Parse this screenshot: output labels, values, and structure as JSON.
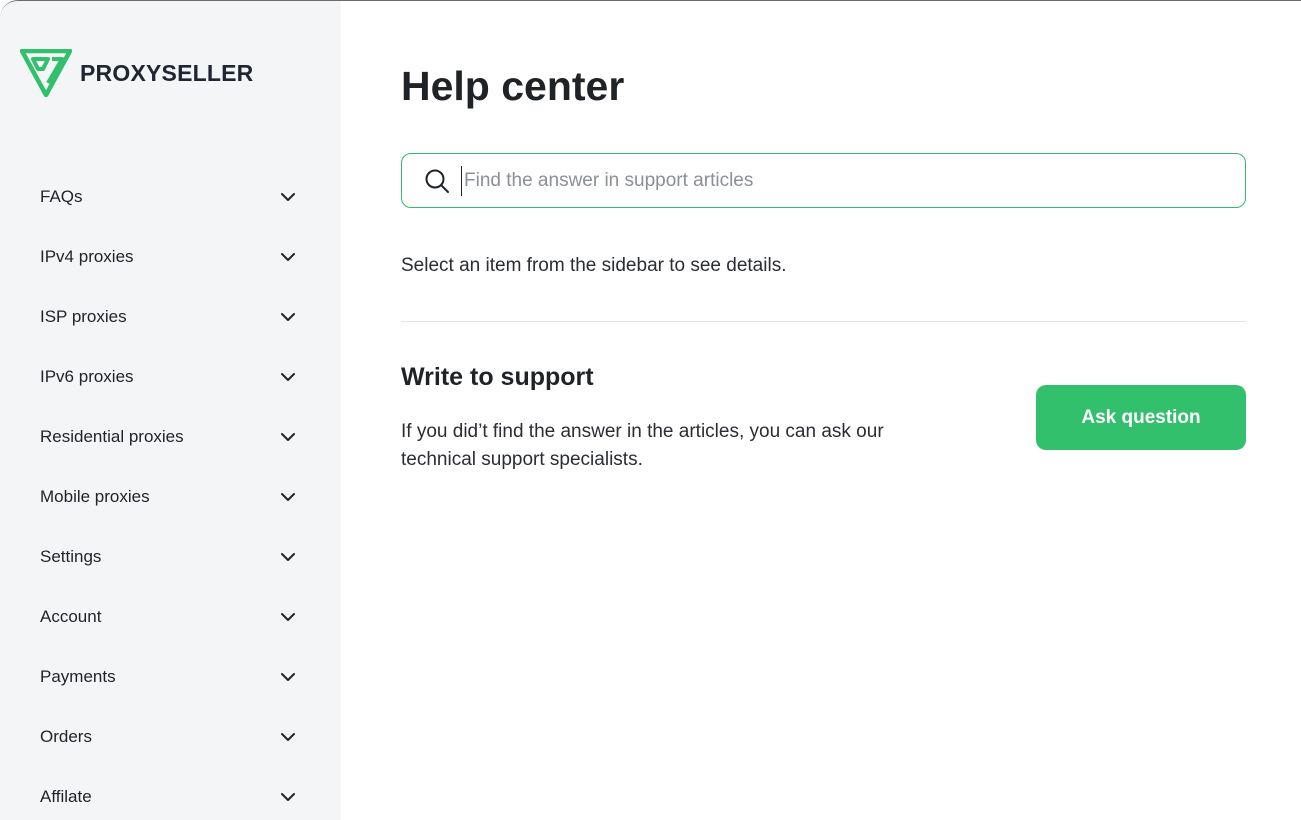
{
  "brand": {
    "name": "PROXYSELLER",
    "accent_color": "#33c06d",
    "logo_icon": "proxyseller-logo-icon"
  },
  "sidebar": {
    "items": [
      {
        "label": "FAQs",
        "icon": "chevron-down-icon"
      },
      {
        "label": "IPv4 proxies",
        "icon": "chevron-down-icon"
      },
      {
        "label": "ISP proxies",
        "icon": "chevron-down-icon"
      },
      {
        "label": "IPv6 proxies",
        "icon": "chevron-down-icon"
      },
      {
        "label": "Residential proxies",
        "icon": "chevron-down-icon"
      },
      {
        "label": "Mobile proxies",
        "icon": "chevron-down-icon"
      },
      {
        "label": "Settings",
        "icon": "chevron-down-icon"
      },
      {
        "label": "Account",
        "icon": "chevron-down-icon"
      },
      {
        "label": "Payments",
        "icon": "chevron-down-icon"
      },
      {
        "label": "Orders",
        "icon": "chevron-down-icon"
      },
      {
        "label": "Affilate",
        "icon": "chevron-down-icon"
      }
    ]
  },
  "main": {
    "title": "Help center",
    "search": {
      "placeholder": "Find the answer in support articles",
      "value": "",
      "icon": "search-icon"
    },
    "hint": "Select an item from the sidebar to see details.",
    "support": {
      "title": "Write to support",
      "text": "If you did’t find the answer in the articles, you can ask our technical support specialists.",
      "button_label": "Ask question"
    }
  }
}
